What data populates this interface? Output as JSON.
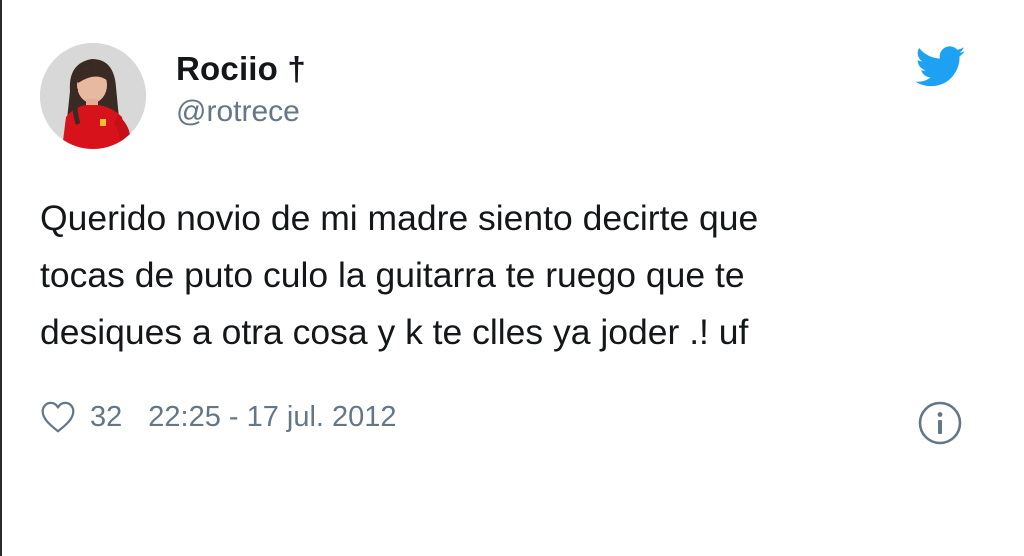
{
  "tweet": {
    "author": {
      "display_name": "Rociio †",
      "handle": "@rotrece",
      "avatar": "avatar-photo"
    },
    "lines": [
      "Querido novio de mi madre siento decirte que",
      "tocas de puto culo la guitarra te ruego que te",
      "desiques a otra cosa y k te clles ya joder .! uf"
    ],
    "likes": "32",
    "timestamp": "22:25 - 17 jul. 2012"
  },
  "icons": {
    "brand": "twitter-bird-icon",
    "like": "heart-icon",
    "info": "info-icon"
  },
  "colors": {
    "brand_blue": "#1da1f2",
    "text_primary": "#14171a",
    "text_secondary": "#657786",
    "background": "#ffffff"
  }
}
